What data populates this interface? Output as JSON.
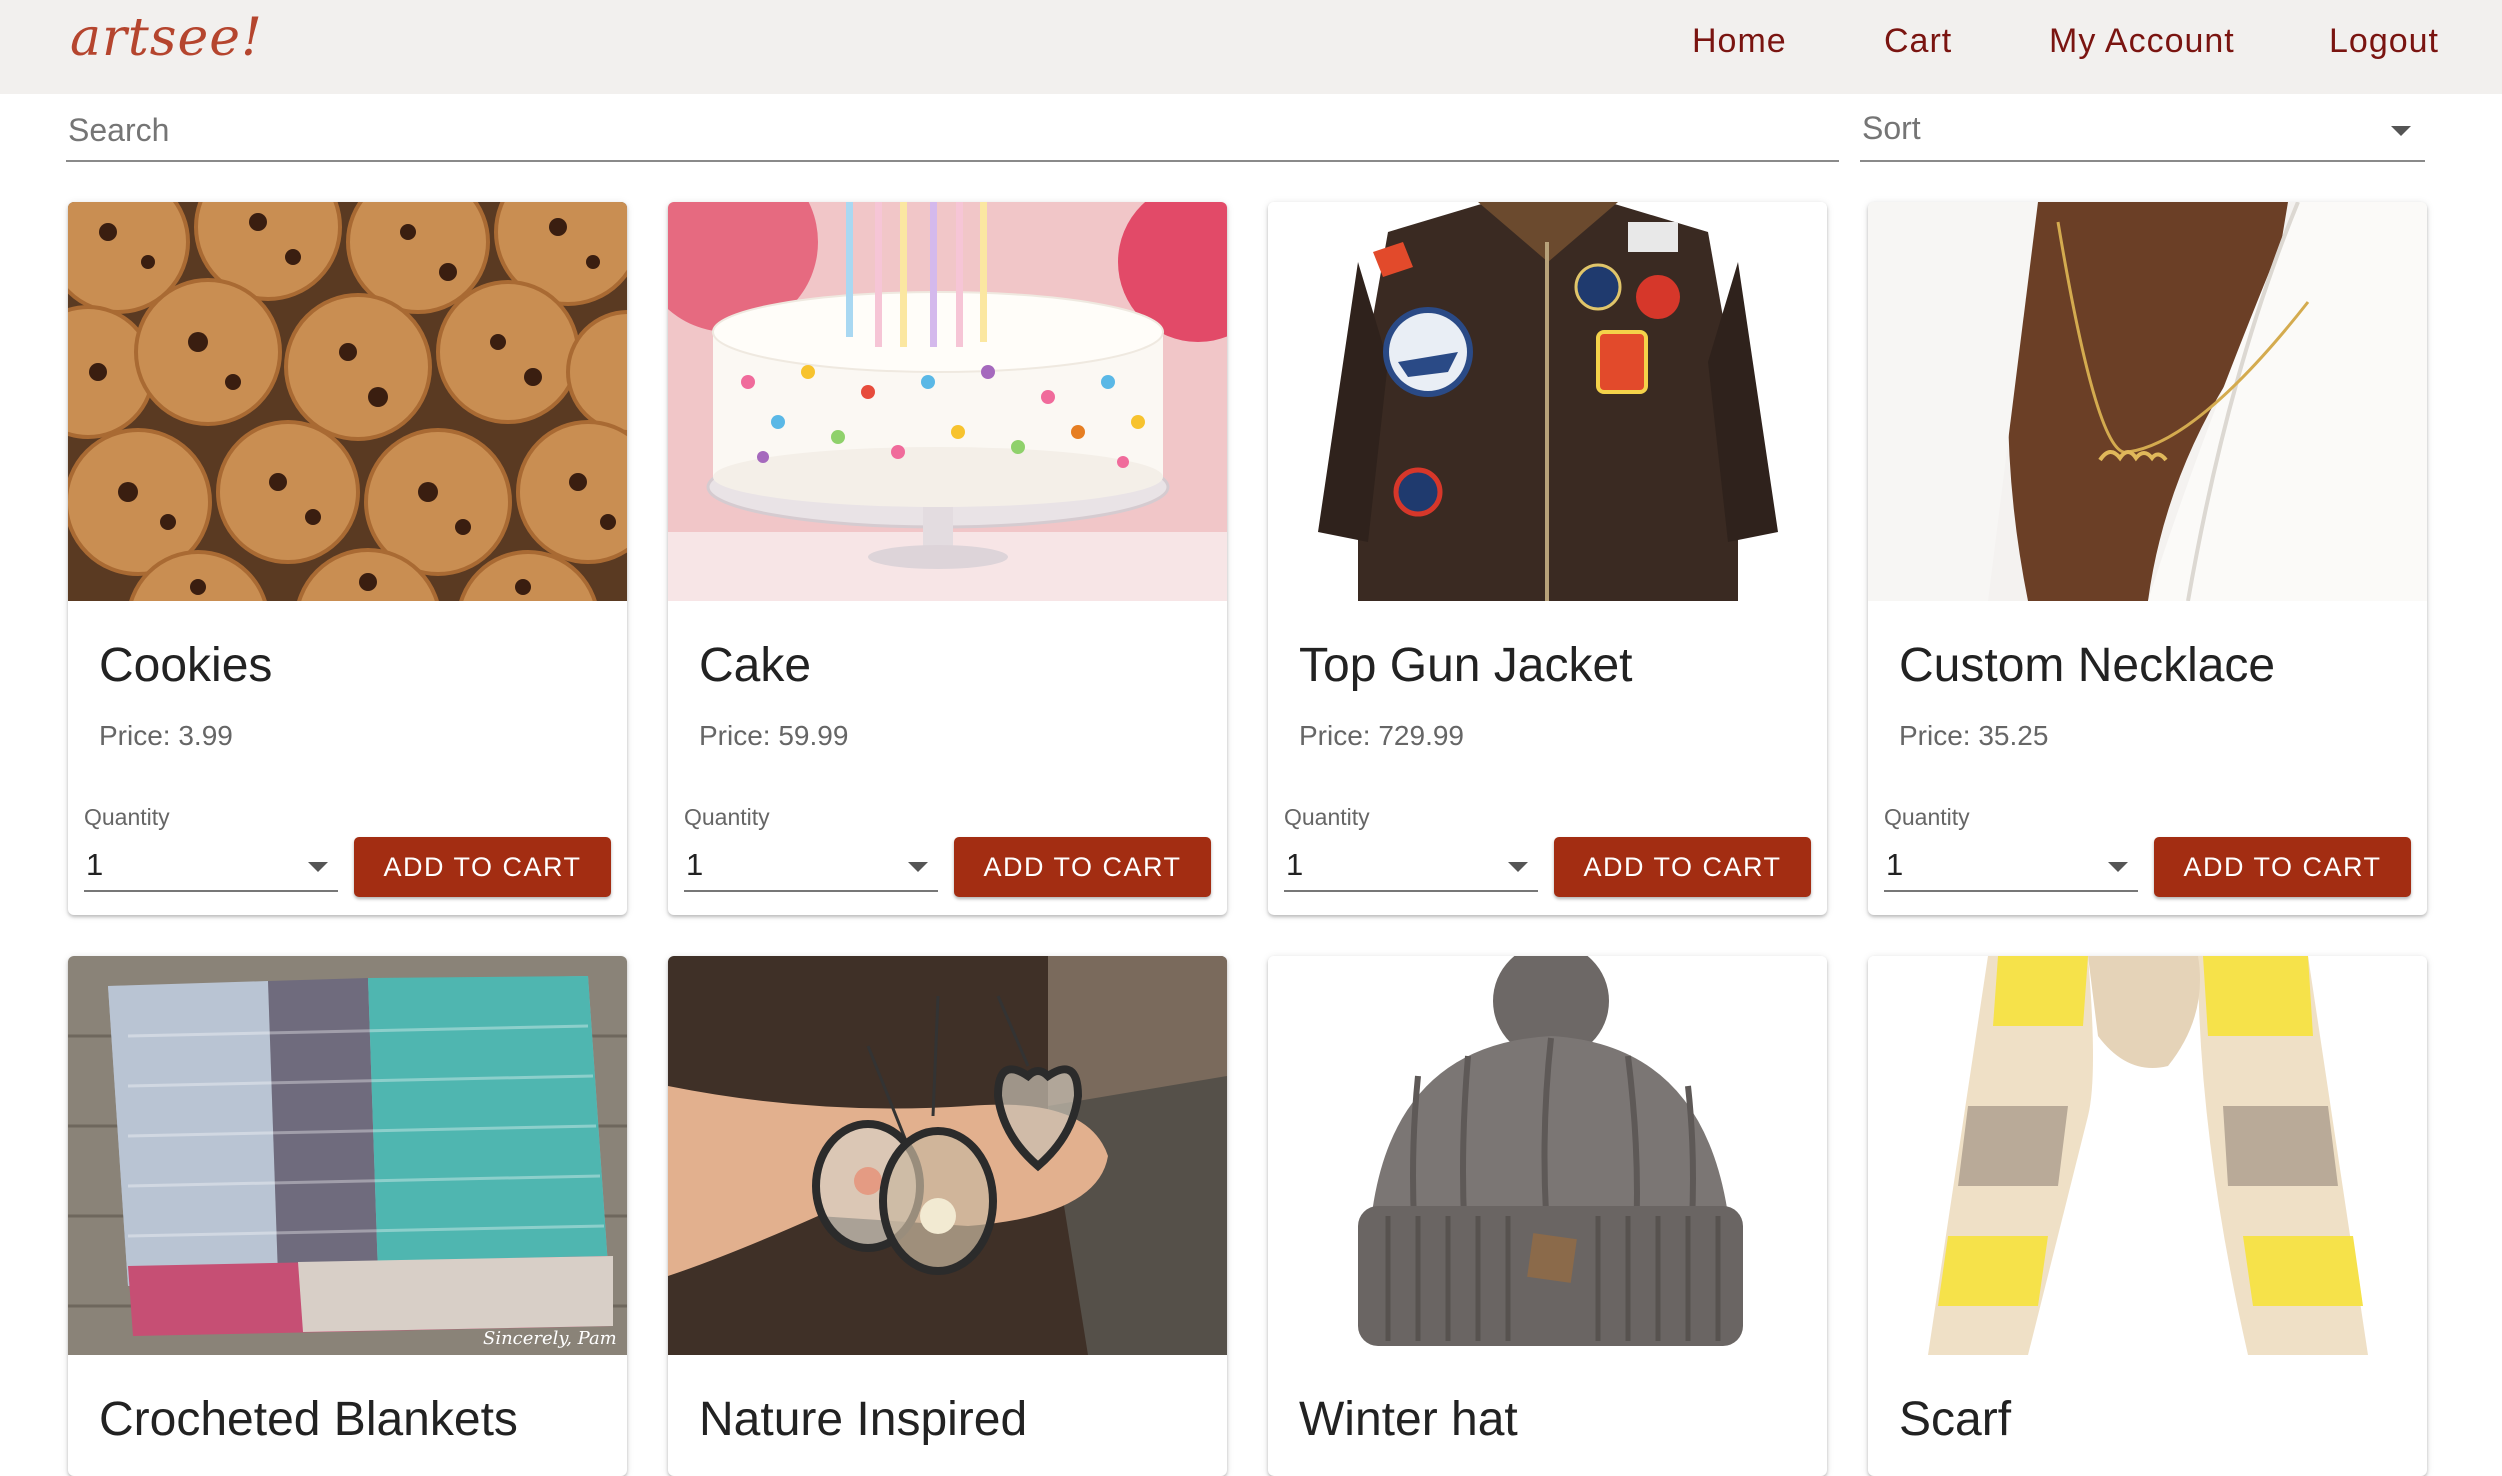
{
  "brand": {
    "logo": "artsee!"
  },
  "nav": {
    "home": "Home",
    "cart": "Cart",
    "account": "My Account",
    "logout": "Logout"
  },
  "search": {
    "placeholder": "Search",
    "value": ""
  },
  "sort": {
    "label": "Sort"
  },
  "products": [
    {
      "title": "Cookies",
      "price": "Price: 3.99",
      "quantity_label": "Quantity",
      "quantity": "1",
      "button": "ADD TO CART",
      "image": "chocolate-chip-cookies-photo"
    },
    {
      "title": "Cake",
      "price": "Price: 59.99",
      "quantity_label": "Quantity",
      "quantity": "1",
      "button": "ADD TO CART",
      "image": "birthday-cake-photo"
    },
    {
      "title": "Top Gun Jacket",
      "price": "Price: 729.99",
      "quantity_label": "Quantity",
      "quantity": "1",
      "button": "ADD TO CART",
      "image": "leather-bomber-jacket-photo"
    },
    {
      "title": "Custom Necklace",
      "price": "Price: 35.25",
      "quantity_label": "Quantity",
      "quantity": "1",
      "button": "ADD TO CART",
      "image": "name-necklace-photo"
    },
    {
      "title": "Crocheted Blankets",
      "image": "crocheted-blankets-photo"
    },
    {
      "title": "Nature Inspired",
      "image": "pressed-flower-pendants-photo"
    },
    {
      "title": "Winter hat",
      "image": "knit-beanie-photo"
    },
    {
      "title": "Scarf",
      "image": "knit-scarf-photo"
    }
  ],
  "colors": {
    "header_bg": "#f2f0ee",
    "brand": "#b5452e",
    "nav_text": "#7a1410",
    "button": "#a32d12"
  }
}
